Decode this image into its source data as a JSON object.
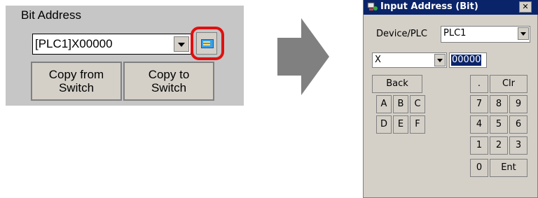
{
  "left": {
    "bit_label": "Bit Address",
    "address_value": "[PLC1]X00000",
    "copy_from": "Copy from\nSwitch",
    "copy_to": "Copy to\nSwitch"
  },
  "dialog": {
    "title": "Input Address (Bit)",
    "close": "✕",
    "device_label": "Device/PLC",
    "device_value": "PLC1",
    "device_type": "X",
    "address_number": "00000",
    "keys": {
      "back": "Back",
      "dot": ".",
      "clr": "Clr",
      "a": "A",
      "b": "B",
      "c": "C",
      "d": "D",
      "e": "E",
      "f": "F",
      "n7": "7",
      "n8": "8",
      "n9": "9",
      "n4": "4",
      "n5": "5",
      "n6": "6",
      "n1": "1",
      "n2": "2",
      "n3": "3",
      "n0": "0",
      "ent": "Ent"
    }
  },
  "colors": {
    "highlight": "#e01010",
    "title_bar": "#0a246a",
    "arrow": "#808080"
  },
  "icons": [
    "keyboard-icon",
    "app-icon",
    "close-icon",
    "chevron-down-icon",
    "arrow-right-icon"
  ]
}
